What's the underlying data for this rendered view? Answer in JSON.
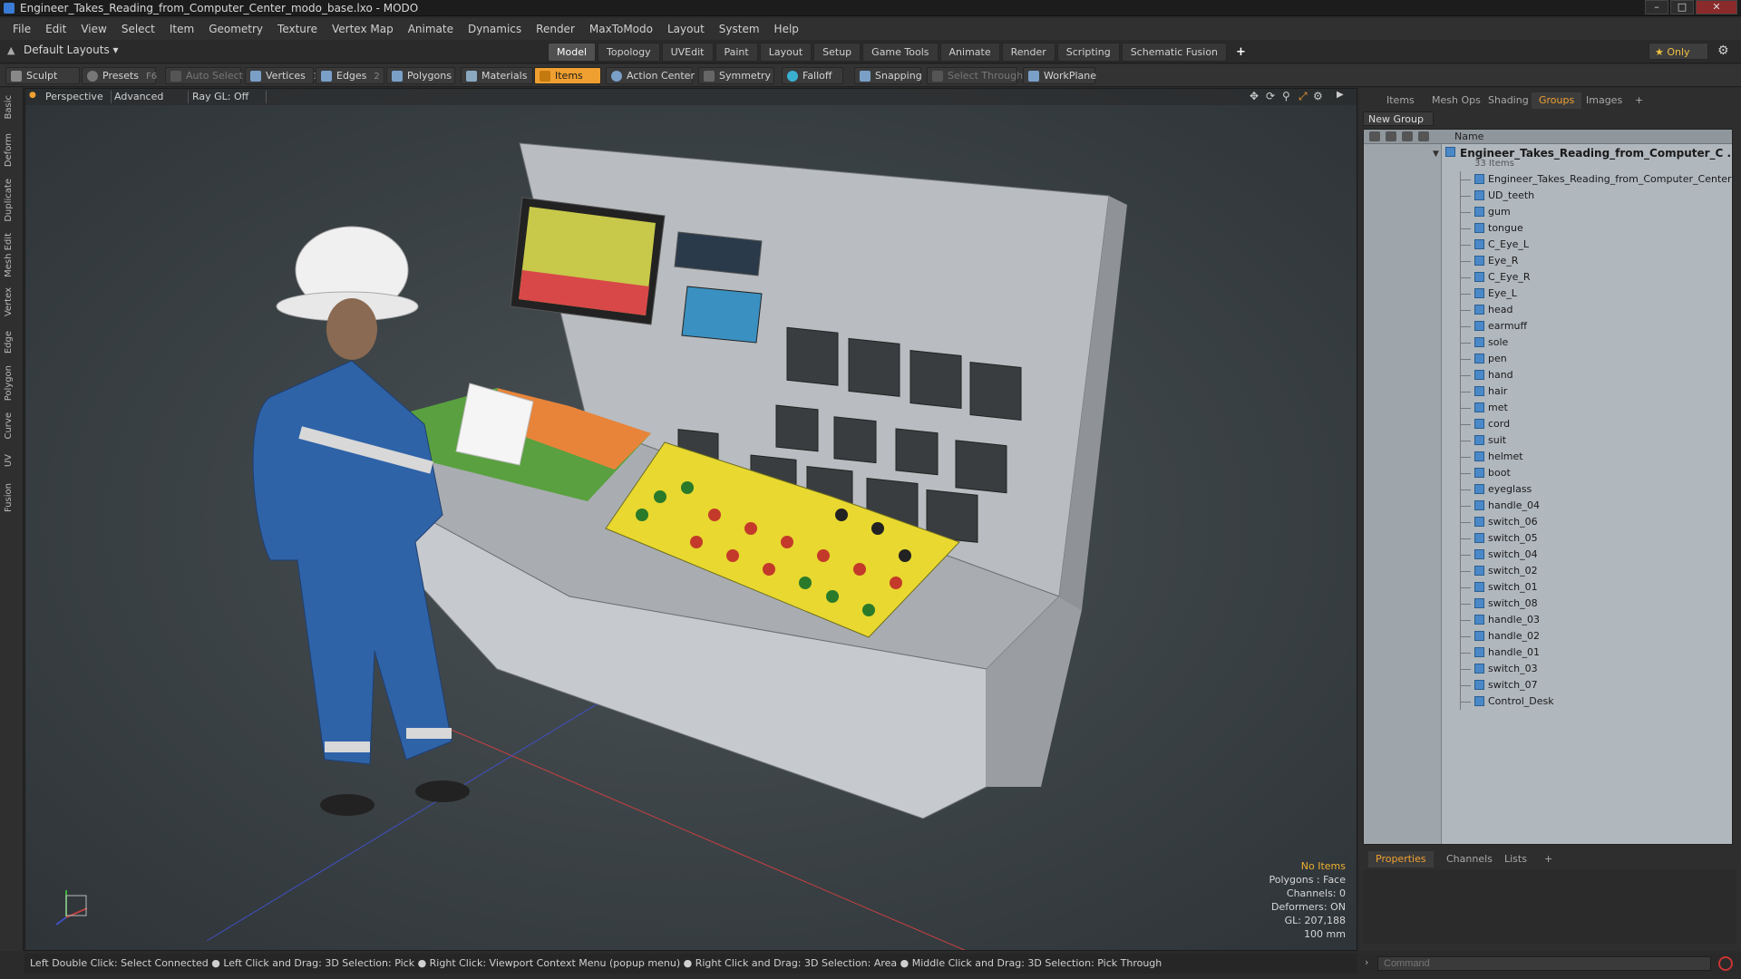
{
  "window": {
    "title": "Engineer_Takes_Reading_from_Computer_Center_modo_base.lxo - MODO",
    "controls": [
      "–",
      "□",
      "✕"
    ]
  },
  "menu": [
    "File",
    "Edit",
    "View",
    "Select",
    "Item",
    "Geometry",
    "Texture",
    "Vertex Map",
    "Animate",
    "Dynamics",
    "Render",
    "MaxToModo",
    "Layout",
    "System",
    "Help"
  ],
  "layout": {
    "selector": "Default Layouts ▾",
    "tabs": [
      "Model",
      "Topology",
      "UVEdit",
      "Paint",
      "Layout",
      "Setup",
      "Game Tools",
      "Animate",
      "Render",
      "Scripting",
      "Schematic Fusion"
    ],
    "active_tab": "Model",
    "add": "+",
    "only_label": "★  Only",
    "gear": "⚙"
  },
  "toolbar": {
    "sculpt": "Sculpt",
    "presets": "Presets",
    "presets_key": "F6",
    "auto_select": "Auto Select",
    "vertices": "Vertices",
    "vertices_key": "1",
    "edges": "Edges",
    "edges_key": "2",
    "polygons": "Polygons",
    "materials": "Materials",
    "items": "Items",
    "action_center": "Action Center",
    "symmetry": "Symmetry",
    "falloff": "Falloff",
    "snapping": "Snapping",
    "select_through": "Select Through",
    "workplane": "WorkPlane"
  },
  "left_tabs": [
    "Basic",
    "Deform",
    "Duplicate",
    "Mesh Edit",
    "Vertex",
    "Edge",
    "Polygon",
    "Curve",
    "UV",
    "Fusion"
  ],
  "viewport": {
    "perspective": "Perspective",
    "advanced": "Advanced",
    "raygl": "Ray GL: Off",
    "info": {
      "no_items": "No Items",
      "polygons": "Polygons : Face",
      "channels": "Channels: 0",
      "deformers": "Deformers: ON",
      "gl": "GL: 207,188",
      "scale": "100 mm"
    }
  },
  "right_panel": {
    "tabs": [
      "Items",
      "Mesh Ops",
      "Shading",
      "Groups",
      "Images",
      "+"
    ],
    "active_tab": "Groups",
    "new_group": "New Group",
    "name_header": "Name",
    "group_title": "Engineer_Takes_Reading_from_Computer_C ...",
    "group_count": "33 Items",
    "items": [
      "Engineer_Takes_Reading_from_Computer_Center",
      "UD_teeth",
      "gum",
      "tongue",
      "C_Eye_L",
      "Eye_R",
      "C_Eye_R",
      "Eye_L",
      "head",
      "earmuff",
      "sole",
      "pen",
      "hand",
      "hair",
      "met",
      "cord",
      "suit",
      "helmet",
      "boot",
      "eyeglass",
      "handle_04",
      "switch_06",
      "switch_05",
      "switch_04",
      "switch_02",
      "switch_01",
      "switch_08",
      "handle_03",
      "handle_02",
      "handle_01",
      "switch_03",
      "switch_07",
      "Control_Desk"
    ],
    "bottom_tabs": [
      "Properties",
      "Channels",
      "Lists",
      "+"
    ],
    "bottom_active": "Properties"
  },
  "status": "Left Double Click: Select Connected ● Left Click and Drag: 3D Selection: Pick ● Right Click: Viewport Context Menu (popup menu) ● Right Click and Drag: 3D Selection: Area ● Middle Click and Drag: 3D Selection: Pick Through",
  "command": {
    "placeholder": "Command"
  },
  "colors": {
    "accent": "#f0a030",
    "panel": "#2e2e2e",
    "viewport_bg": "#3b4246"
  }
}
